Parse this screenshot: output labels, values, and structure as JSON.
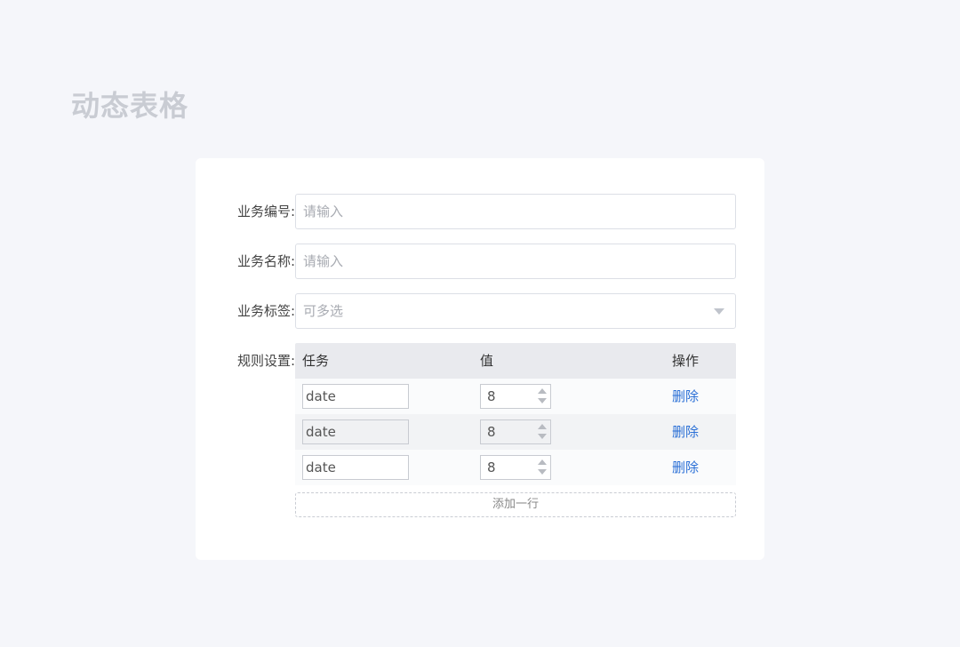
{
  "page": {
    "title": "动态表格"
  },
  "form": {
    "business_no": {
      "label": "业务编号:",
      "placeholder": "请输入",
      "value": ""
    },
    "business_name": {
      "label": "业务名称:",
      "placeholder": "请输入",
      "value": ""
    },
    "business_tags": {
      "label": "业务标签:",
      "placeholder": "可多选"
    },
    "rules": {
      "label": "规则设置:",
      "columns": {
        "task": "任务",
        "value": "值",
        "action": "操作"
      },
      "rows": [
        {
          "task": "date",
          "value": "8",
          "action": "删除"
        },
        {
          "task": "date",
          "value": "8",
          "action": "删除"
        },
        {
          "task": "date",
          "value": "8",
          "action": "删除"
        }
      ],
      "add_label": "添加一行"
    }
  },
  "colors": {
    "background": "#f5f6fa",
    "title": "#c9ccd3",
    "link": "#2a6fd6",
    "header_bg": "#e9eaee"
  },
  "icons": {
    "select_caret": "chevron-down-icon",
    "spinner": "number-spinner-icon"
  }
}
